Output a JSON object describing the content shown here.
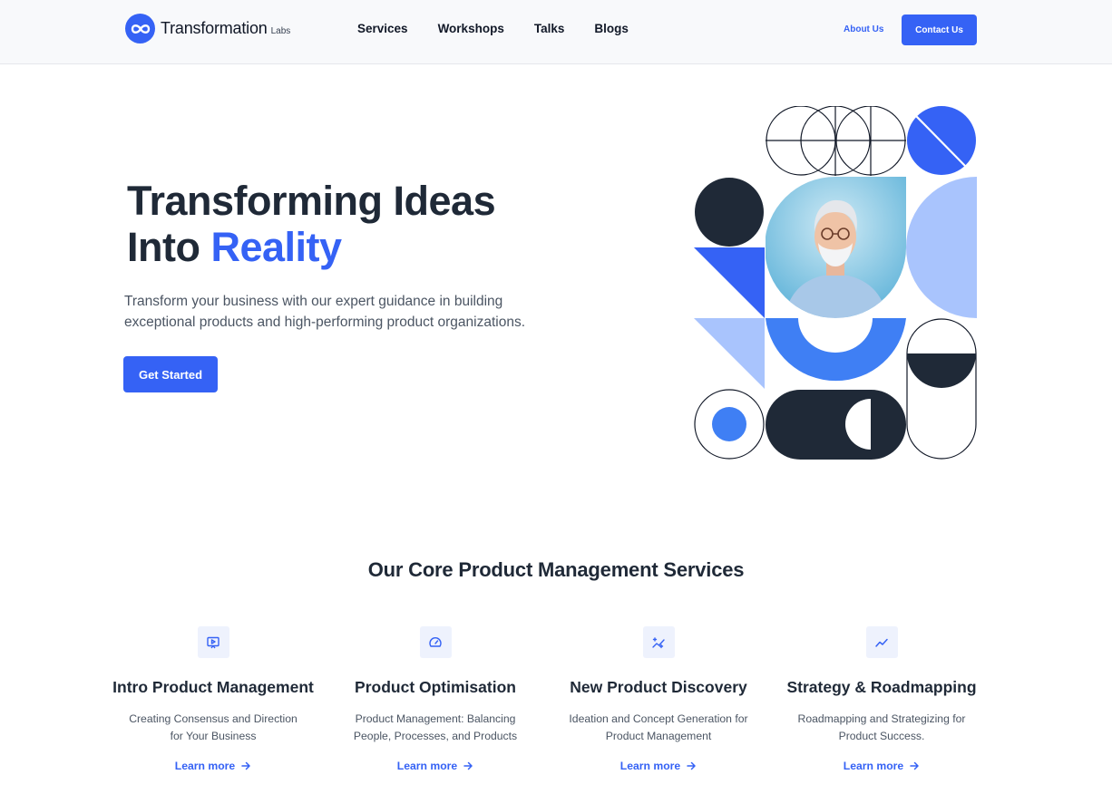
{
  "header": {
    "logo_name": "Transformation",
    "logo_sub": "Labs",
    "nav": [
      "Services",
      "Workshops",
      "Talks",
      "Blogs"
    ],
    "about_label": "About Us",
    "contact_label": "Contact Us"
  },
  "hero": {
    "title_line1": "Transforming Ideas",
    "title_into": "Into",
    "title_accent": "Reality",
    "subtitle": "Transform your business with our expert guidance in building exceptional products and high-performing product organizations.",
    "cta_label": "Get Started"
  },
  "services": {
    "title": "Our Core Product Management Services",
    "cards": [
      {
        "icon": "presentation-play-icon",
        "title": "Intro Product Management",
        "desc": "Creating Consensus and Direction for Your Business",
        "link": "Learn more"
      },
      {
        "icon": "gauge-icon",
        "title": "Product Optimisation",
        "desc": "Product Management: Balancing People, Processes, and Products",
        "link": "Learn more"
      },
      {
        "icon": "sparkles-icon",
        "title": "New Product Discovery",
        "desc": "Ideation and Concept Generation for Product Management",
        "link": "Learn more"
      },
      {
        "icon": "trending-up-icon",
        "title": "Strategy & Roadmapping",
        "desc": "Roadmapping and Strategizing for Product Success.",
        "link": "Learn more"
      }
    ]
  },
  "colors": {
    "accent": "#3562f5",
    "dark": "#1f2937",
    "light_blue": "#a9c4fd",
    "mid_blue": "#3f7ff4"
  }
}
